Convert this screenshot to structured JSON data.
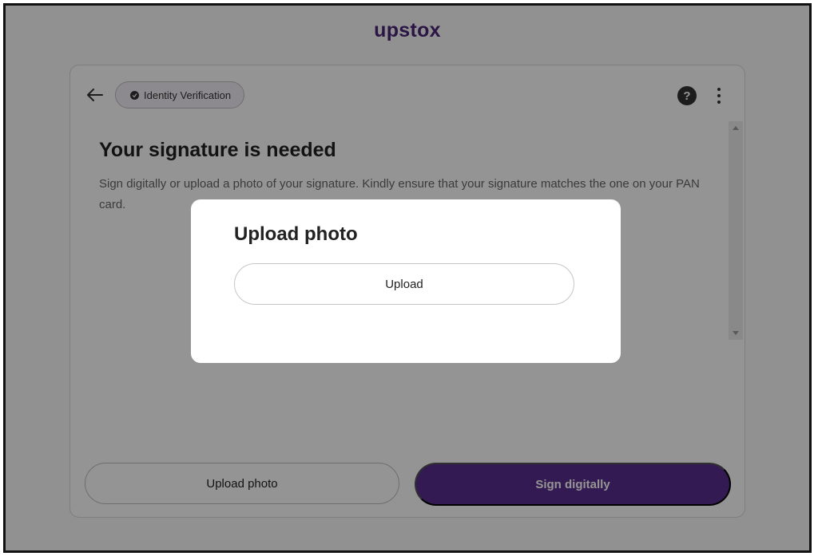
{
  "brand": {
    "logo_text": "upstox",
    "accent_color": "#5b2e8e"
  },
  "header": {
    "back_icon": "arrow-left-icon",
    "chip_label": "Identity Verification",
    "chip_icon": "check-circle-icon",
    "help_label": "?",
    "more_icon": "more-vertical-icon"
  },
  "content": {
    "title": "Your signature is needed",
    "description": "Sign digitally or upload a photo of your signature. Kindly ensure that your signature matches the one on your PAN card."
  },
  "footer": {
    "upload_photo_label": "Upload photo",
    "sign_digitally_label": "Sign digitally"
  },
  "modal": {
    "title": "Upload photo",
    "upload_label": "Upload"
  }
}
